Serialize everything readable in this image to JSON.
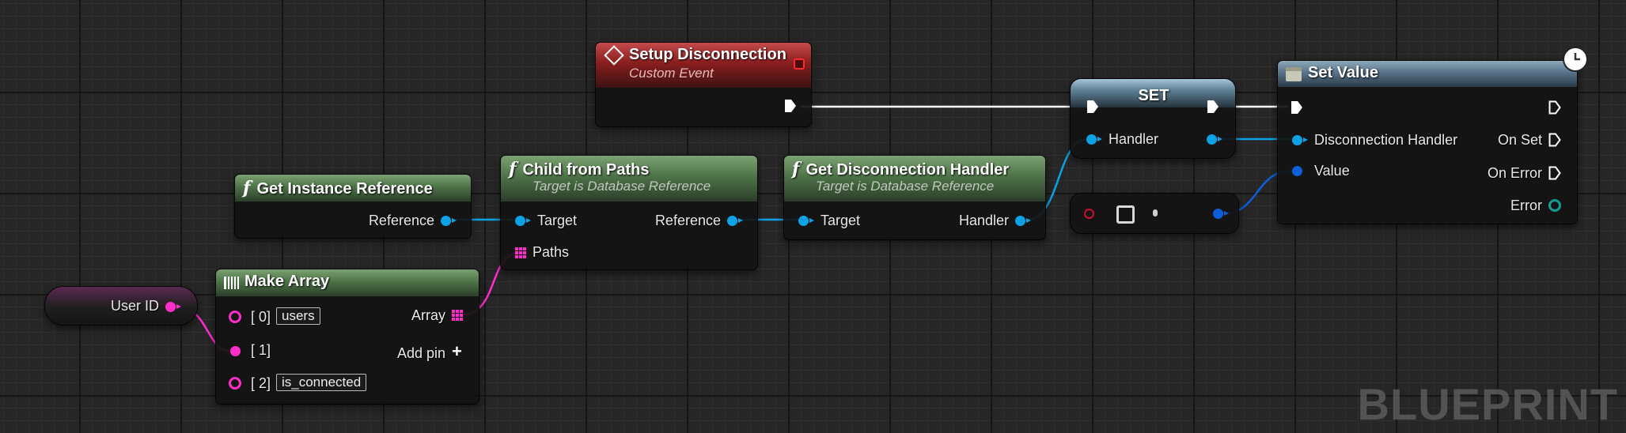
{
  "app": {
    "watermark": "BLUEPRINT"
  },
  "nodes": {
    "setup_disconnection": {
      "title": "Setup Disconnection",
      "subtitle": "Custom Event"
    },
    "set": {
      "title": "SET",
      "pin_handler": "Handler"
    },
    "set_value": {
      "title": "Set Value",
      "pin_disconnection_handler": "Disconnection Handler",
      "pin_value": "Value",
      "pin_on_set": "On Set",
      "pin_on_error": "On Error",
      "pin_error": "Error"
    },
    "get_instance_reference": {
      "title": "Get Instance Reference",
      "pin_reference": "Reference"
    },
    "child_from_paths": {
      "title": "Child from Paths",
      "subtitle": "Target is Database Reference",
      "pin_target": "Target",
      "pin_paths": "Paths",
      "pin_reference": "Reference"
    },
    "get_disconnection_handler": {
      "title": "Get Disconnection Handler",
      "subtitle": "Target is Database Reference",
      "pin_target": "Target",
      "pin_handler": "Handler"
    },
    "user_id": {
      "label": "User ID"
    },
    "make_array": {
      "title": "Make Array",
      "pin_0": "[ 0]",
      "pin_0_value": "users",
      "pin_1": "[ 1]",
      "pin_2": "[ 2]",
      "pin_2_value": "is_connected",
      "pin_array": "Array",
      "add_pin": "Add pin"
    }
  },
  "icons": {
    "event": "event-diamond-icon",
    "function": "function-icon",
    "make_array": "make-array-icon",
    "set_value": "set-value-icon",
    "latent": "clock-icon",
    "add": "plus-icon"
  },
  "colors": {
    "exec": "#ffffff",
    "object": "#0ca3e6",
    "struct": "#0c5fd8",
    "string": "#ff2ecb",
    "error": "#149e8f",
    "function_header": "#4e7348",
    "event_header": "#8a1e1e",
    "variable_header": "#5e7f95"
  }
}
